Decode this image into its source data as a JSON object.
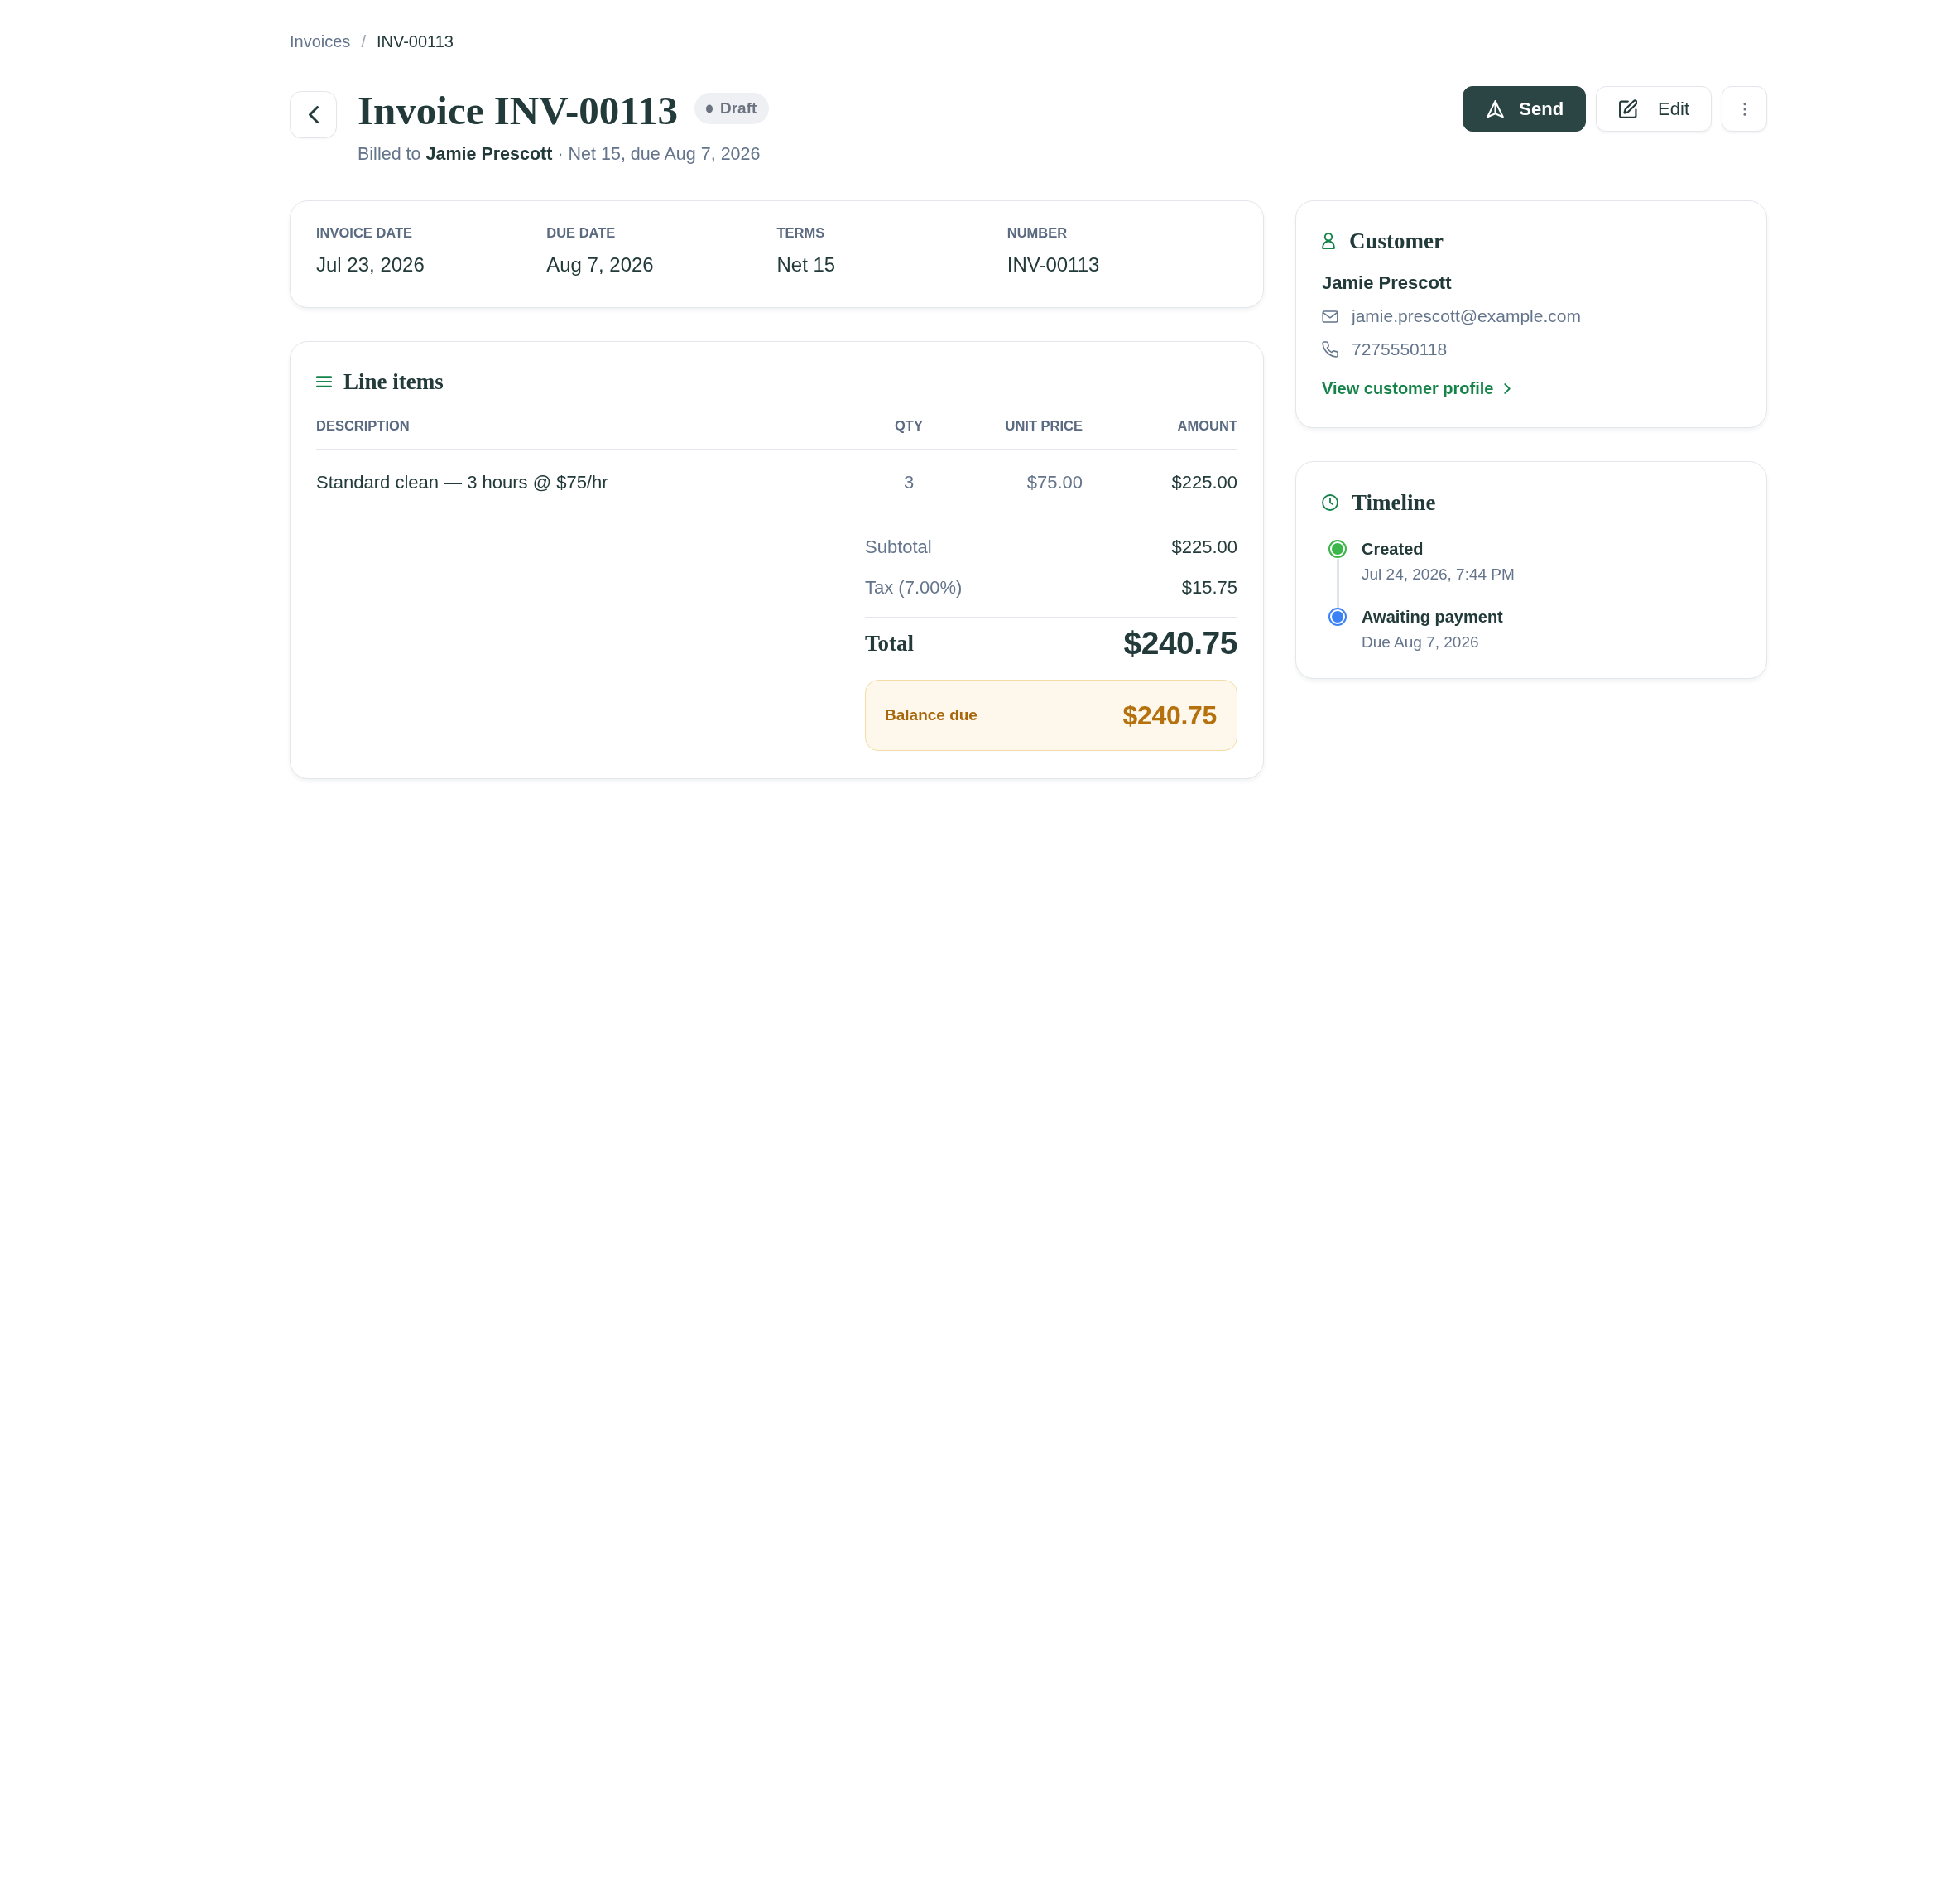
{
  "breadcrumb": {
    "separator": "/",
    "items": [
      {
        "label": "Invoices",
        "current": false
      },
      {
        "label": "INV-00113",
        "current": true
      }
    ]
  },
  "header": {
    "title": "Invoice INV-00113",
    "status": "Draft",
    "subtitle": "Billed to **Jamie Prescott** · Net 15, due Aug 7, 2026"
  },
  "actions": [
    {
      "kind": "send",
      "label": "Send"
    },
    {
      "kind": "edit",
      "label": "Edit"
    },
    {
      "kind": "more"
    }
  ],
  "details": [
    {
      "label": "INVOICE DATE",
      "value": "Jul 23, 2026"
    },
    {
      "label": "DUE DATE",
      "value": "Aug 7, 2026"
    },
    {
      "label": "TERMS",
      "value": "Net 15"
    },
    {
      "label": "NUMBER",
      "value": "INV-00113"
    }
  ],
  "line_items": {
    "title": "Line items",
    "columns": [
      "DESCRIPTION",
      "QTY",
      "UNIT PRICE",
      "AMOUNT"
    ],
    "rows": [
      [
        "Standard clean — 3 hours @ $75/hr",
        "3",
        "$75.00",
        "$225.00"
      ]
    ],
    "summary": [
      {
        "label": "Subtotal",
        "value": "$225.00"
      },
      {
        "label": "Tax (7.00%)",
        "value": "$15.75"
      }
    ],
    "total": {
      "label": "Total",
      "value": "$240.75"
    },
    "balance": {
      "label": "Balance due",
      "value": "$240.75"
    }
  },
  "customer": {
    "title": "Customer",
    "name": "Jamie Prescott",
    "contacts": [
      {
        "kind": "email",
        "value": "jamie.prescott@example.com"
      },
      {
        "kind": "phone",
        "value": "7275550118"
      }
    ],
    "link": "View customer profile"
  },
  "timeline": {
    "title": "Timeline",
    "events": [
      {
        "label": "Created",
        "detail": "Jul 24, 2026, 7:44 PM",
        "color": "#3cb54a"
      },
      {
        "label": "Awaiting payment",
        "detail": "Due Aug 7, 2026",
        "color": "#3b82f6"
      }
    ]
  }
}
